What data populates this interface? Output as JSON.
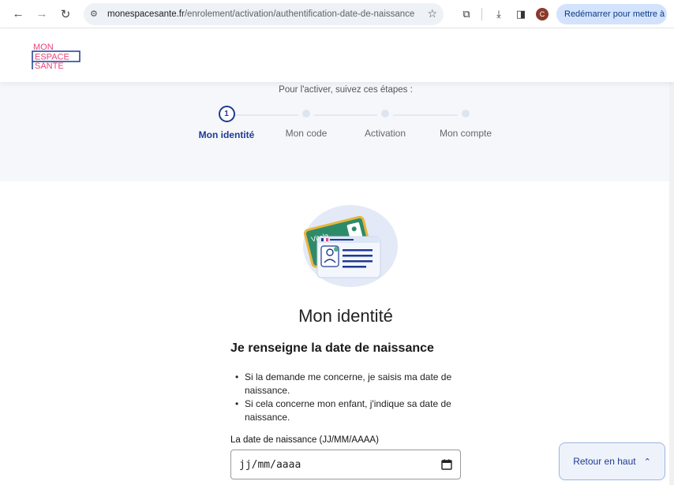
{
  "browser": {
    "url_host": "monespacesante.fr",
    "url_path": "/enrolement/activation/authentification-date-de-naissance",
    "avatar_letter": "C",
    "update_button": "Redémarrer pour mettre à jour"
  },
  "header": {
    "logo_lines": [
      "MON",
      "ESPACE",
      "SANTE"
    ]
  },
  "steps": {
    "intro": "Pour l'activer, suivez ces étapes :",
    "items": [
      {
        "number": "1",
        "label": "Mon identité",
        "active": true
      },
      {
        "number": "",
        "label": "Mon code",
        "active": false
      },
      {
        "number": "",
        "label": "Activation",
        "active": false
      },
      {
        "number": "",
        "label": "Mon compte",
        "active": false
      }
    ]
  },
  "main": {
    "card_text": "Vitale",
    "title": "Mon identité",
    "section_title": "Je renseigne la date de naissance",
    "bullets": [
      "Si la demande me concerne, je saisis ma date de naissance.",
      "Si cela concerne mon enfant, j'indique sa date de naissance."
    ],
    "field_label": "La date de naissance (JJ/MM/AAAA)",
    "date_placeholder": "jj/mm/aaaa"
  },
  "back_to_top": {
    "label": "Retour en haut"
  },
  "colors": {
    "brand_pink": "#e8457a",
    "brand_blue": "#1f3a93",
    "band_bg": "#f5f7fb"
  }
}
